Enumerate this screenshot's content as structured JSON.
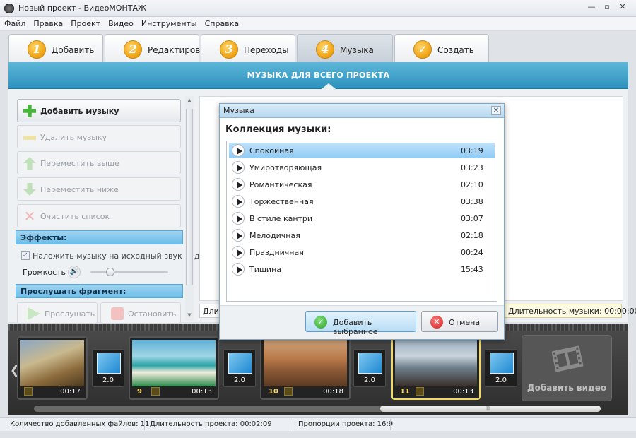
{
  "window": {
    "title": "Новый проект - ВидеоМОНТАЖ"
  },
  "menu": [
    "Файл",
    "Правка",
    "Проект",
    "Видео",
    "Инструменты",
    "Справка"
  ],
  "tabs": [
    {
      "num": "1",
      "label": "Добавить"
    },
    {
      "num": "2",
      "label": "Редактировать"
    },
    {
      "num": "3",
      "label": "Переходы"
    },
    {
      "num": "4",
      "label": "Музыка",
      "active": true
    },
    {
      "num": "✓",
      "label": "Создать"
    }
  ],
  "section_header": "МУЗЫКА ДЛЯ ВСЕГО ПРОЕКТА",
  "left_panel": {
    "add_music": "Добавить музыку",
    "remove_music": "Удалить музыку",
    "move_up": "Переместить выше",
    "move_down": "Переместить ниже",
    "clear_list": "Очистить список",
    "effects_title": "Эффекты:",
    "overlay_label": "Наложить музыку на исходный звук видео",
    "volume_label": "Громкость",
    "listen_title": "Прослушать фрагмент:",
    "listen": "Прослушать",
    "stop": "Остановить",
    "volume_level": 0.22
  },
  "duration_left": "Дли",
  "duration_right": "Длительность музыки: 00:00:00",
  "dialog": {
    "title": "Музыка",
    "heading": "Коллекция музыки:",
    "tracks": [
      {
        "name": "Спокойная",
        "duration": "03:19"
      },
      {
        "name": "Умиротворяющая",
        "duration": "03:23"
      },
      {
        "name": "Романтическая",
        "duration": "02:10"
      },
      {
        "name": "Торжественная",
        "duration": "03:38"
      },
      {
        "name": "В стиле кантри",
        "duration": "03:07"
      },
      {
        "name": "Мелодичная",
        "duration": "02:18"
      },
      {
        "name": "Праздничная",
        "duration": "00:24"
      },
      {
        "name": "Тишина",
        "duration": "15:43"
      }
    ],
    "selected_index": 0,
    "ok": "Добавить выбранное",
    "cancel": "Отмена"
  },
  "timeline": {
    "clips": [
      {
        "index": "",
        "time": "00:17"
      },
      {
        "index": "9",
        "time": "00:13"
      },
      {
        "index": "10",
        "time": "00:18"
      },
      {
        "index": "11",
        "time": "00:13",
        "selected": true
      }
    ],
    "transitions": [
      "2.0",
      "2.0",
      "2.0",
      "2.0"
    ],
    "add_video": "Добавить видео"
  },
  "status": {
    "files": "Количество добавленных файлов: 11",
    "duration": "Длительность проекта:  00:02:09",
    "ratio": "Пропорции проекта:  16:9"
  },
  "colors": {
    "accent": "#2f93bd",
    "section": "#6dbde8",
    "selected_clip": "#f0d86a"
  }
}
